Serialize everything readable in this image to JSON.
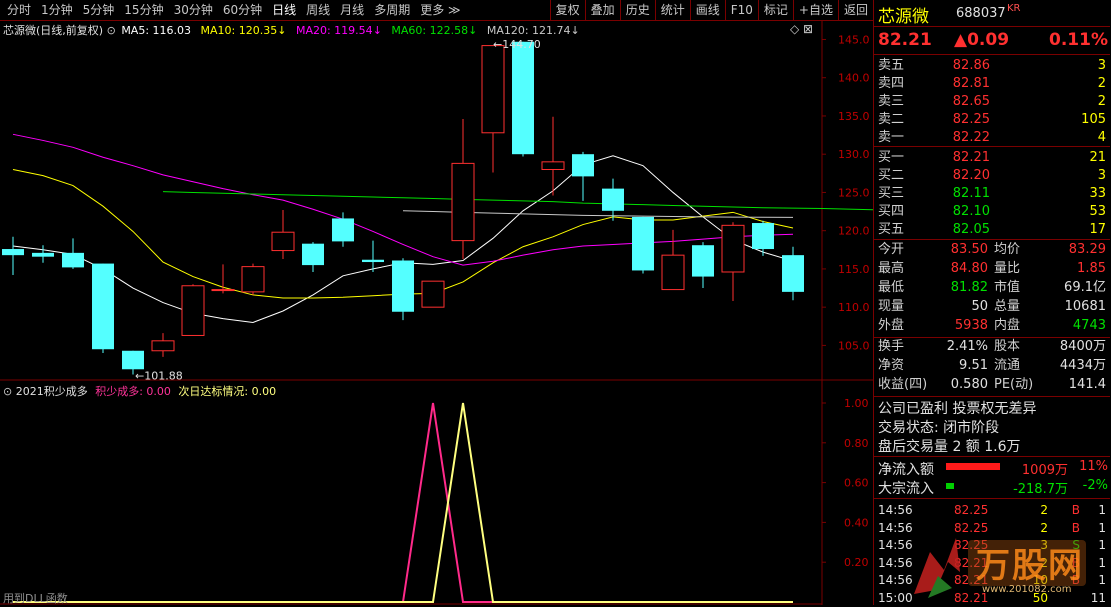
{
  "toolbar": {
    "left": [
      "分时",
      "1分钟",
      "5分钟",
      "15分钟",
      "30分钟",
      "60分钟",
      "日线",
      "周线",
      "月线",
      "多周期",
      "更多 ≫"
    ],
    "active": "日线",
    "right": [
      "复权",
      "叠加",
      "历史",
      "统计",
      "画线",
      "F10",
      "标记",
      "+自选",
      "返回"
    ]
  },
  "main_header": {
    "name": "芯源微(日线,前复权)",
    "ma5": "MA5: 116.03",
    "ma10": "MA10: 120.35",
    "ma20": "MA20: 119.54",
    "ma60": "MA60: 122.58",
    "ma120": "MA120: 121.74",
    "max_label": "144.70",
    "min_label": "101.88"
  },
  "sub_header": {
    "name": "2021积少成多",
    "ind1": "积少成多: 0.00",
    "ind2": "次日达标情况: 0.00",
    "footer": "用到DLL函数"
  },
  "colors": {
    "up": "#ff3030",
    "down": "#54ffff",
    "ma5": "#ffffff",
    "ma10": "#ffff00",
    "ma20": "#ff00ff",
    "ma60": "#00e000",
    "ma120": "#c8c8c8",
    "grid": "#7a0000"
  },
  "chart_data": [
    {
      "type": "candlestick",
      "title": "芯源微(日线,前复权)",
      "y_ticks": [
        "145.0",
        "140.0",
        "135.0",
        "130.0",
        "125.0",
        "120.0",
        "115.0",
        "110.0",
        "105.0"
      ],
      "ylim": [
        101.0,
        146.5
      ],
      "candles": [
        {
          "o": 117.6,
          "c": 116.8,
          "h": 119.2,
          "l": 114.2
        },
        {
          "o": 117.1,
          "c": 116.6,
          "h": 118.1,
          "l": 115.8
        },
        {
          "o": 117.1,
          "c": 115.2,
          "h": 119.0,
          "l": 115.0
        },
        {
          "o": 115.7,
          "c": 104.5,
          "h": 115.7,
          "l": 104.0
        },
        {
          "o": 104.3,
          "c": 101.88,
          "h": 104.3,
          "l": 101.2
        },
        {
          "o": 104.3,
          "c": 105.6,
          "h": 106.6,
          "l": 103.5
        },
        {
          "o": 106.3,
          "c": 112.8,
          "h": 113.0,
          "l": 106.3
        },
        {
          "o": 112.2,
          "c": 112.3,
          "h": 115.6,
          "l": 111.8
        },
        {
          "o": 112.0,
          "c": 115.3,
          "h": 115.7,
          "l": 111.6
        },
        {
          "o": 117.4,
          "c": 119.8,
          "h": 122.7,
          "l": 116.3
        },
        {
          "o": 118.3,
          "c": 115.5,
          "h": 118.5,
          "l": 114.6
        },
        {
          "o": 121.6,
          "c": 118.6,
          "h": 122.4,
          "l": 117.9
        },
        {
          "o": 116.2,
          "c": 115.9,
          "h": 118.7,
          "l": 114.6
        },
        {
          "o": 116.1,
          "c": 109.4,
          "h": 116.4,
          "l": 108.3
        },
        {
          "o": 110.0,
          "c": 113.4,
          "h": 113.4,
          "l": 110.0
        },
        {
          "o": 118.7,
          "c": 128.8,
          "h": 134.6,
          "l": 116.3
        },
        {
          "o": 132.8,
          "c": 144.2,
          "h": 144.2,
          "l": 127.6
        },
        {
          "o": 144.7,
          "c": 130.0,
          "h": 144.7,
          "l": 129.7
        },
        {
          "o": 128.0,
          "c": 129.0,
          "h": 134.9,
          "l": 124.6
        },
        {
          "o": 130.0,
          "c": 127.1,
          "h": 130.3,
          "l": 123.9
        },
        {
          "o": 125.5,
          "c": 122.6,
          "h": 126.8,
          "l": 121.3
        },
        {
          "o": 121.8,
          "c": 114.8,
          "h": 121.8,
          "l": 114.4
        },
        {
          "o": 112.3,
          "c": 116.8,
          "h": 120.1,
          "l": 112.3
        },
        {
          "o": 118.1,
          "c": 114.0,
          "h": 118.5,
          "l": 112.5
        },
        {
          "o": 114.6,
          "c": 120.7,
          "h": 121.1,
          "l": 110.8
        },
        {
          "o": 121.0,
          "c": 117.6,
          "h": 121.3,
          "l": 116.7
        },
        {
          "o": 116.8,
          "c": 112.0,
          "h": 117.9,
          "l": 110.9
        }
      ],
      "series": [
        {
          "name": "MA5",
          "values": [
            118.0,
            117.5,
            116.9,
            115.0,
            112.5,
            110.6,
            109.2,
            108.5,
            108.0,
            109.5,
            111.6,
            114.1,
            115.0,
            115.8,
            115.6,
            116.1,
            119.0,
            122.6,
            125.2,
            128.6,
            129.8,
            128.5,
            125.0,
            121.8,
            118.8,
            117.2,
            116.03
          ]
        },
        {
          "name": "MA10",
          "values": [
            128.0,
            127.2,
            125.9,
            123.2,
            119.9,
            115.9,
            114.0,
            112.6,
            111.6,
            111.2,
            111.2,
            111.3,
            111.5,
            111.7,
            111.8,
            113.3,
            115.8,
            117.9,
            119.2,
            120.8,
            121.8,
            121.4,
            121.4,
            121.9,
            122.4,
            121.2,
            120.35
          ]
        },
        {
          "name": "MA20",
          "values": [
            132.6,
            131.8,
            130.9,
            129.6,
            128.5,
            127.3,
            126.4,
            125.5,
            124.7,
            124.0,
            122.8,
            121.5,
            119.9,
            118.2,
            116.6,
            115.5,
            116.0,
            116.8,
            117.5,
            118.0,
            118.2,
            118.4,
            118.6,
            118.9,
            119.2,
            119.4,
            119.54
          ]
        },
        {
          "name": "MA60",
          "values": [
            125.1,
            125.0,
            124.9,
            124.8,
            124.7,
            124.6,
            124.5,
            124.4,
            124.3,
            124.2,
            124.1,
            124.0,
            123.9,
            123.8,
            123.6,
            123.5,
            123.4,
            123.3,
            123.2,
            123.1,
            123.0,
            122.95,
            122.9,
            122.8,
            122.7,
            122.6,
            122.58
          ],
          "start": 5
        },
        {
          "name": "MA120",
          "values": [
            122.6,
            122.5,
            122.4,
            122.3,
            122.2,
            122.1,
            122.0,
            121.95,
            121.9,
            121.85,
            121.8,
            121.78,
            121.76,
            121.74
          ],
          "start": 13
        }
      ]
    },
    {
      "type": "line",
      "title": "2021积少成多",
      "y_ticks": [
        "1.00",
        "0.80",
        "0.60",
        "0.40",
        "0.20"
      ],
      "ylim": [
        0,
        1.0
      ],
      "series": [
        {
          "name": "积少成多",
          "values": [
            0,
            0,
            0,
            0,
            0,
            0,
            0,
            0,
            0,
            0,
            0,
            0,
            0,
            0,
            1,
            0,
            0,
            0,
            0,
            0,
            0,
            0,
            0,
            0,
            0,
            0,
            0
          ]
        },
        {
          "name": "次日达标情况",
          "values": [
            0,
            0,
            0,
            0,
            0,
            0,
            0,
            0,
            0,
            0,
            0,
            0,
            0,
            0,
            0,
            1,
            0,
            0,
            0,
            0,
            0,
            0,
            0,
            0,
            0,
            0,
            0
          ]
        }
      ]
    }
  ],
  "quote": {
    "name": "芯源微",
    "code": "688037",
    "market": "KR",
    "price": "82.21",
    "change": "▲0.09",
    "pct": "0.11%",
    "sell": [
      {
        "label": "卖五",
        "price": "82.86",
        "vol": "3"
      },
      {
        "label": "卖四",
        "price": "82.81",
        "vol": "2"
      },
      {
        "label": "卖三",
        "price": "82.65",
        "vol": "2"
      },
      {
        "label": "卖二",
        "price": "82.25",
        "vol": "105"
      },
      {
        "label": "卖一",
        "price": "82.22",
        "vol": "4"
      }
    ],
    "buy": [
      {
        "label": "买一",
        "price": "82.21",
        "vol": "21"
      },
      {
        "label": "买二",
        "price": "82.20",
        "vol": "3"
      },
      {
        "label": "买三",
        "price": "82.11",
        "vol": "33"
      },
      {
        "label": "买四",
        "price": "82.10",
        "vol": "53"
      },
      {
        "label": "买五",
        "price": "82.05",
        "vol": "17"
      }
    ],
    "stats": [
      {
        "l1": "今开",
        "v1": "83.50",
        "l2": "均价",
        "v2": "83.29",
        "c1": "red",
        "c2": "red"
      },
      {
        "l1": "最高",
        "v1": "84.80",
        "l2": "量比",
        "v2": "1.85",
        "c1": "red",
        "c2": "red"
      },
      {
        "l1": "最低",
        "v1": "81.82",
        "l2": "市值",
        "v2": "69.1亿",
        "c1": "green",
        "c2": "wht"
      },
      {
        "l1": "现量",
        "v1": "50",
        "l2": "总量",
        "v2": "10681",
        "c1": "wht",
        "c2": "wht"
      },
      {
        "l1": "外盘",
        "v1": "5938",
        "l2": "内盘",
        "v2": "4743",
        "c1": "red",
        "c2": "green"
      }
    ],
    "stats2": [
      {
        "l1": "换手",
        "v1": "2.41%",
        "l2": "股本",
        "v2": "8400万"
      },
      {
        "l1": "净资",
        "v1": "9.51",
        "l2": "流通",
        "v2": "4434万"
      },
      {
        "l1": "收益(四)",
        "v1": "0.580",
        "l2": "PE(动)",
        "v2": "141.4"
      }
    ],
    "info": [
      "公司已盈利 投票权无差异",
      "交易状态: 闭市阶段",
      "盘后交易量 2 额 1.6万"
    ],
    "flows": [
      {
        "label": "净流入额",
        "value": "1009万",
        "pct": "11%"
      },
      {
        "label": "大宗流入",
        "value": "-218.7万",
        "pct": "-2%"
      }
    ],
    "ticks": [
      {
        "t": "14:56",
        "p": "82.25",
        "v": "2",
        "s": "B",
        "n": "1"
      },
      {
        "t": "14:56",
        "p": "82.25",
        "v": "2",
        "s": "B",
        "n": "1"
      },
      {
        "t": "14:56",
        "p": "82.25",
        "v": "3",
        "s": "S",
        "n": "1"
      },
      {
        "t": "14:56",
        "p": "82.21",
        "v": "2",
        "s": "B",
        "n": "1"
      },
      {
        "t": "14:56",
        "p": "82.21",
        "v": "10",
        "s": "B",
        "n": "1"
      },
      {
        "t": "15:00",
        "p": "82.21",
        "v": "50",
        "s": "",
        "n": "11"
      }
    ],
    "watermark": "万股网",
    "watermark_url": "www.201082.com"
  }
}
